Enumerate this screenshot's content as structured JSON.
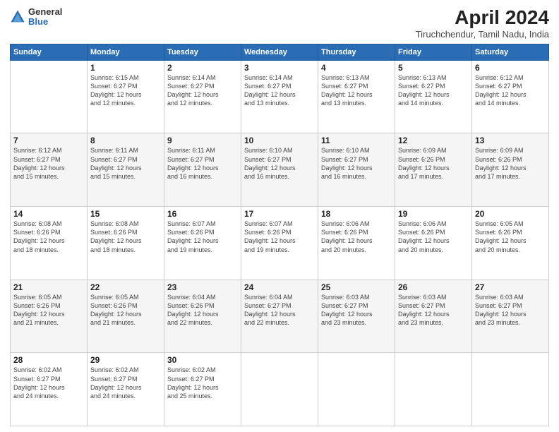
{
  "logo": {
    "general": "General",
    "blue": "Blue"
  },
  "title": "April 2024",
  "location": "Tiruchchendur, Tamil Nadu, India",
  "days": [
    "Sunday",
    "Monday",
    "Tuesday",
    "Wednesday",
    "Thursday",
    "Friday",
    "Saturday"
  ],
  "weeks": [
    [
      {
        "day": "",
        "info": ""
      },
      {
        "day": "1",
        "info": "Sunrise: 6:15 AM\nSunset: 6:27 PM\nDaylight: 12 hours\nand 12 minutes."
      },
      {
        "day": "2",
        "info": "Sunrise: 6:14 AM\nSunset: 6:27 PM\nDaylight: 12 hours\nand 12 minutes."
      },
      {
        "day": "3",
        "info": "Sunrise: 6:14 AM\nSunset: 6:27 PM\nDaylight: 12 hours\nand 13 minutes."
      },
      {
        "day": "4",
        "info": "Sunrise: 6:13 AM\nSunset: 6:27 PM\nDaylight: 12 hours\nand 13 minutes."
      },
      {
        "day": "5",
        "info": "Sunrise: 6:13 AM\nSunset: 6:27 PM\nDaylight: 12 hours\nand 14 minutes."
      },
      {
        "day": "6",
        "info": "Sunrise: 6:12 AM\nSunset: 6:27 PM\nDaylight: 12 hours\nand 14 minutes."
      }
    ],
    [
      {
        "day": "7",
        "info": "Sunrise: 6:12 AM\nSunset: 6:27 PM\nDaylight: 12 hours\nand 15 minutes."
      },
      {
        "day": "8",
        "info": "Sunrise: 6:11 AM\nSunset: 6:27 PM\nDaylight: 12 hours\nand 15 minutes."
      },
      {
        "day": "9",
        "info": "Sunrise: 6:11 AM\nSunset: 6:27 PM\nDaylight: 12 hours\nand 16 minutes."
      },
      {
        "day": "10",
        "info": "Sunrise: 6:10 AM\nSunset: 6:27 PM\nDaylight: 12 hours\nand 16 minutes."
      },
      {
        "day": "11",
        "info": "Sunrise: 6:10 AM\nSunset: 6:27 PM\nDaylight: 12 hours\nand 16 minutes."
      },
      {
        "day": "12",
        "info": "Sunrise: 6:09 AM\nSunset: 6:26 PM\nDaylight: 12 hours\nand 17 minutes."
      },
      {
        "day": "13",
        "info": "Sunrise: 6:09 AM\nSunset: 6:26 PM\nDaylight: 12 hours\nand 17 minutes."
      }
    ],
    [
      {
        "day": "14",
        "info": "Sunrise: 6:08 AM\nSunset: 6:26 PM\nDaylight: 12 hours\nand 18 minutes."
      },
      {
        "day": "15",
        "info": "Sunrise: 6:08 AM\nSunset: 6:26 PM\nDaylight: 12 hours\nand 18 minutes."
      },
      {
        "day": "16",
        "info": "Sunrise: 6:07 AM\nSunset: 6:26 PM\nDaylight: 12 hours\nand 19 minutes."
      },
      {
        "day": "17",
        "info": "Sunrise: 6:07 AM\nSunset: 6:26 PM\nDaylight: 12 hours\nand 19 minutes."
      },
      {
        "day": "18",
        "info": "Sunrise: 6:06 AM\nSunset: 6:26 PM\nDaylight: 12 hours\nand 20 minutes."
      },
      {
        "day": "19",
        "info": "Sunrise: 6:06 AM\nSunset: 6:26 PM\nDaylight: 12 hours\nand 20 minutes."
      },
      {
        "day": "20",
        "info": "Sunrise: 6:05 AM\nSunset: 6:26 PM\nDaylight: 12 hours\nand 20 minutes."
      }
    ],
    [
      {
        "day": "21",
        "info": "Sunrise: 6:05 AM\nSunset: 6:26 PM\nDaylight: 12 hours\nand 21 minutes."
      },
      {
        "day": "22",
        "info": "Sunrise: 6:05 AM\nSunset: 6:26 PM\nDaylight: 12 hours\nand 21 minutes."
      },
      {
        "day": "23",
        "info": "Sunrise: 6:04 AM\nSunset: 6:26 PM\nDaylight: 12 hours\nand 22 minutes."
      },
      {
        "day": "24",
        "info": "Sunrise: 6:04 AM\nSunset: 6:27 PM\nDaylight: 12 hours\nand 22 minutes."
      },
      {
        "day": "25",
        "info": "Sunrise: 6:03 AM\nSunset: 6:27 PM\nDaylight: 12 hours\nand 23 minutes."
      },
      {
        "day": "26",
        "info": "Sunrise: 6:03 AM\nSunset: 6:27 PM\nDaylight: 12 hours\nand 23 minutes."
      },
      {
        "day": "27",
        "info": "Sunrise: 6:03 AM\nSunset: 6:27 PM\nDaylight: 12 hours\nand 23 minutes."
      }
    ],
    [
      {
        "day": "28",
        "info": "Sunrise: 6:02 AM\nSunset: 6:27 PM\nDaylight: 12 hours\nand 24 minutes."
      },
      {
        "day": "29",
        "info": "Sunrise: 6:02 AM\nSunset: 6:27 PM\nDaylight: 12 hours\nand 24 minutes."
      },
      {
        "day": "30",
        "info": "Sunrise: 6:02 AM\nSunset: 6:27 PM\nDaylight: 12 hours\nand 25 minutes."
      },
      {
        "day": "",
        "info": ""
      },
      {
        "day": "",
        "info": ""
      },
      {
        "day": "",
        "info": ""
      },
      {
        "day": "",
        "info": ""
      }
    ]
  ]
}
